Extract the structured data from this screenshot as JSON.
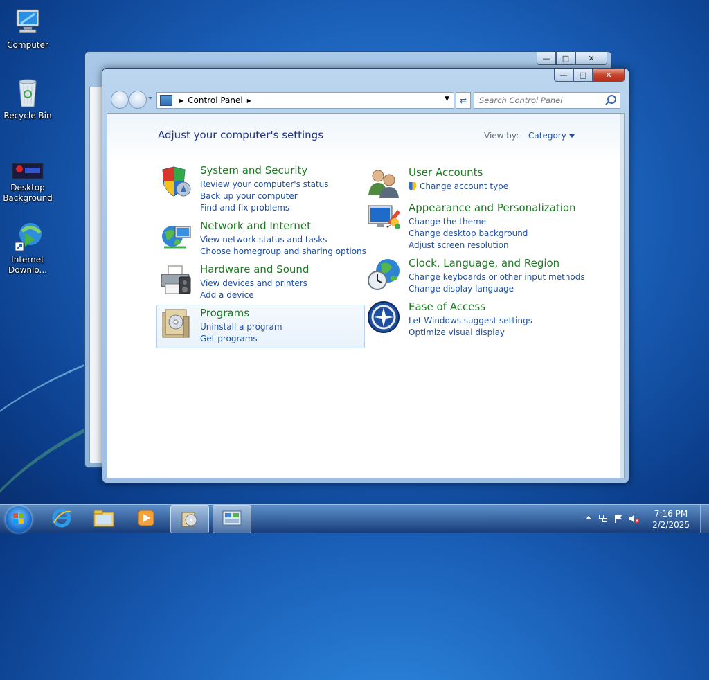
{
  "desktop": {
    "icons": [
      {
        "label": "Computer"
      },
      {
        "label": "Recycle Bin"
      },
      {
        "label": "Desktop Background"
      },
      {
        "label": "Internet Downlo..."
      }
    ]
  },
  "window": {
    "address": {
      "crumbs": [
        "Control Panel"
      ]
    },
    "search": {
      "placeholder": "Search Control Panel"
    },
    "heading": "Adjust your computer's settings",
    "view_by": {
      "label": "View by:",
      "value": "Category"
    },
    "categories": [
      {
        "title": "System and Security",
        "icon": "shield-icon",
        "links": [
          "Review your computer's status",
          "Back up your computer",
          "Find and fix problems"
        ]
      },
      {
        "title": "Network and Internet",
        "icon": "network-icon",
        "links": [
          "View network status and tasks",
          "Choose homegroup and sharing options"
        ]
      },
      {
        "title": "Hardware and Sound",
        "icon": "printer-icon",
        "links": [
          "View devices and printers",
          "Add a device"
        ]
      },
      {
        "title": "Programs",
        "icon": "programs-icon",
        "links": [
          "Uninstall a program",
          "Get programs"
        ]
      },
      {
        "title": "User Accounts",
        "icon": "users-icon",
        "links": [
          "Change account type"
        ]
      },
      {
        "title": "Appearance and Personalization",
        "icon": "monitor-icon",
        "links": [
          "Change the theme",
          "Change desktop background",
          "Adjust screen resolution"
        ]
      },
      {
        "title": "Clock, Language, and Region",
        "icon": "globe-clock-icon",
        "links": [
          "Change keyboards or other input methods",
          "Change display language"
        ]
      },
      {
        "title": "Ease of Access",
        "icon": "ease-of-access-icon",
        "links": [
          "Let Windows suggest settings",
          "Optimize visual display"
        ]
      }
    ]
  },
  "taskbar": {
    "clock": {
      "time": "7:16 PM",
      "date": "2/2/2025"
    }
  }
}
